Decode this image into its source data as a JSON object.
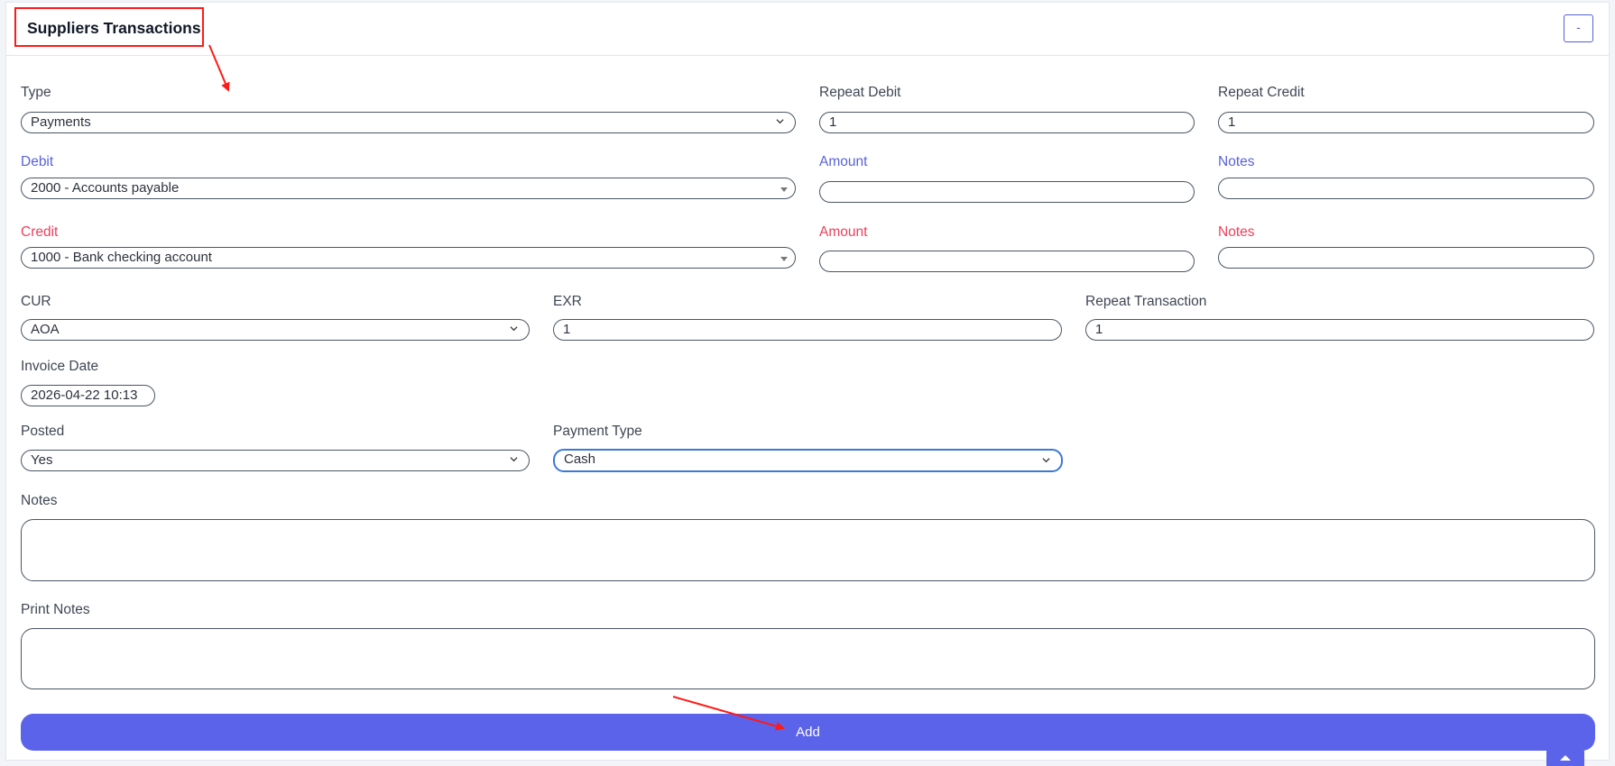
{
  "header": {
    "title": "Suppliers Transactions",
    "collapse_label": "-"
  },
  "form": {
    "type": {
      "label": "Type",
      "value": "Payments"
    },
    "repeat_debit": {
      "label": "Repeat Debit",
      "value": "1"
    },
    "repeat_credit": {
      "label": "Repeat Credit",
      "value": "1"
    },
    "debit": {
      "label": "Debit",
      "value": "2000 - Accounts payable"
    },
    "debit_amount": {
      "label": "Amount",
      "value": ""
    },
    "debit_notes": {
      "label": "Notes",
      "value": ""
    },
    "credit": {
      "label": "Credit",
      "value": "1000 - Bank checking account"
    },
    "credit_amount": {
      "label": "Amount",
      "value": ""
    },
    "credit_notes": {
      "label": "Notes",
      "value": ""
    },
    "cur": {
      "label": "CUR",
      "value": "AOA"
    },
    "exr": {
      "label": "EXR",
      "value": "1"
    },
    "repeat_transaction": {
      "label": "Repeat Transaction",
      "value": "1"
    },
    "invoice_date": {
      "label": "Invoice Date",
      "value": "2026-04-22 10:13"
    },
    "posted": {
      "label": "Posted",
      "value": "Yes"
    },
    "payment_type": {
      "label": "Payment Type",
      "value": "Cash"
    },
    "notes": {
      "label": "Notes",
      "value": ""
    },
    "print_notes": {
      "label": "Print Notes",
      "value": ""
    },
    "add_label": "Add"
  },
  "colors": {
    "primary": "#5b63ea",
    "debit_label": "#5a62d6",
    "credit_label": "#ee3f5c",
    "annotation": "#ff1a1a"
  },
  "icons": [
    "chevron-down-icon",
    "dropdown-triangle-icon",
    "chevron-up-icon",
    "annotation-arrow-icon"
  ]
}
